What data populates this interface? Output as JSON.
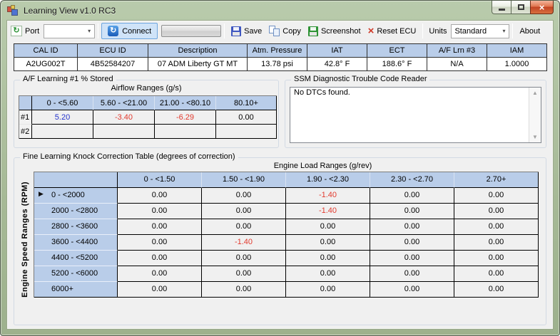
{
  "window": {
    "title": "Learning View v1.0 RC3"
  },
  "icons": {
    "port": "↻",
    "connect": "↻",
    "dropdown": "▾",
    "reset_ecu": "×",
    "close": "×",
    "scroll_up": "▲",
    "scroll_down": "▼",
    "row_selector": "▶"
  },
  "toolbar": {
    "port_label": "Port",
    "port_value": "",
    "connect": "Connect",
    "save": "Save",
    "copy": "Copy",
    "screenshot": "Screenshot",
    "reset_ecu": "Reset ECU",
    "units_label": "Units",
    "units_value": "Standard",
    "about": "About"
  },
  "info": {
    "columns": [
      {
        "label": "CAL ID",
        "value": "A2UG002T"
      },
      {
        "label": "ECU ID",
        "value": "4B52584207"
      },
      {
        "label": "Description",
        "value": "07 ADM Liberty GT MT"
      },
      {
        "label": "Atm. Pressure",
        "value": "13.78 psi"
      },
      {
        "label": "IAT",
        "value": "42.8° F"
      },
      {
        "label": "ECT",
        "value": "188.6° F"
      },
      {
        "label": "A/F Lrn #3",
        "value": "N/A"
      },
      {
        "label": "IAM",
        "value": "1.0000"
      }
    ]
  },
  "af": {
    "title": "A/F Learning #1 % Stored",
    "subtitle": "Airflow Ranges (g/s)",
    "headers": [
      "0 - <5.60",
      "5.60 - <21.00",
      "21.00 - <80.10",
      "80.10+"
    ],
    "rows": [
      {
        "label": "#1",
        "values": [
          "5.20",
          "-3.40",
          "-6.29",
          "0.00"
        ]
      },
      {
        "label": "#2",
        "values": [
          "",
          "",
          "",
          ""
        ]
      }
    ]
  },
  "dtc": {
    "title": "SSM Diagnostic Trouble Code Reader",
    "text": "No DTCs found."
  },
  "knock": {
    "title": "Fine Learning Knock Correction Table (degrees of correction)",
    "subtitle": "Engine Load Ranges (g/rev)",
    "vertical_label": "Engine Speed Ranges (RPM)",
    "headers": [
      "0 - <1.50",
      "1.50 - <1.90",
      "1.90 - <2.30",
      "2.30 - <2.70",
      "2.70+"
    ],
    "rows": [
      {
        "label": "0 - <2000",
        "values": [
          "0.00",
          "0.00",
          "-1.40",
          "0.00",
          "0.00"
        ]
      },
      {
        "label": "2000 - <2800",
        "values": [
          "0.00",
          "0.00",
          "-1.40",
          "0.00",
          "0.00"
        ]
      },
      {
        "label": "2800 - <3600",
        "values": [
          "0.00",
          "0.00",
          "0.00",
          "0.00",
          "0.00"
        ]
      },
      {
        "label": "3600 - <4400",
        "values": [
          "0.00",
          "-1.40",
          "0.00",
          "0.00",
          "0.00"
        ]
      },
      {
        "label": "4400 - <5200",
        "values": [
          "0.00",
          "0.00",
          "0.00",
          "0.00",
          "0.00"
        ]
      },
      {
        "label": "5200 - <6000",
        "values": [
          "0.00",
          "0.00",
          "0.00",
          "0.00",
          "0.00"
        ]
      },
      {
        "label": "6000+",
        "values": [
          "0.00",
          "0.00",
          "0.00",
          "0.00",
          "0.00"
        ]
      }
    ]
  },
  "colors": {
    "table_header_bg": "#b9cde9",
    "negative_value": "#e23a2e",
    "positive_value": "#2333cc",
    "window_border": "#a6b996",
    "connect_highlight": "#cfe3f8",
    "close_button": "#c24424"
  }
}
